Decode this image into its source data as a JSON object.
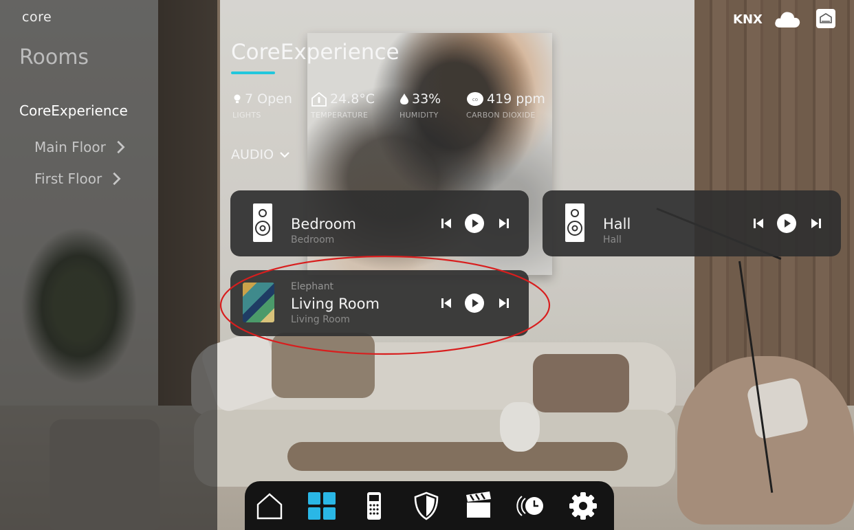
{
  "app": {
    "logo_text": "core"
  },
  "sidebar": {
    "title": "Rooms",
    "home": "CoreExperience",
    "items": [
      {
        "label": "Main Floor"
      },
      {
        "label": "First Floor"
      }
    ]
  },
  "status": {
    "knx": "KNX",
    "icons": [
      "cloud-icon",
      "home-box-icon"
    ]
  },
  "header": {
    "title": "CoreExperience",
    "accent": "#22c7dc"
  },
  "stats": [
    {
      "value": "7 Open",
      "label": "LIGHTS",
      "icon": "bulb-icon"
    },
    {
      "value": "24.8°C",
      "label": "TEMPERATURE",
      "icon": "house-thermo-icon"
    },
    {
      "value": "33%",
      "label": "HUMIDITY",
      "icon": "droplet-icon"
    },
    {
      "value": "419 ppm",
      "label": "CARBON DIOXIDE",
      "icon": "co2-icon"
    }
  ],
  "audio_section": {
    "label": "AUDIO"
  },
  "players": [
    {
      "name": "Bedroom",
      "subtitle": "Bedroom",
      "track": ""
    },
    {
      "name": "Hall",
      "subtitle": "Hall",
      "track": ""
    },
    {
      "name": "Living Room",
      "subtitle": "Living Room",
      "track": "Elephant"
    }
  ],
  "dock": {
    "items": [
      "home-icon",
      "rooms-grid-icon",
      "remote-icon",
      "security-shield-icon",
      "scenes-clapper-icon",
      "schedule-clock-icon",
      "settings-gear-icon"
    ],
    "active": "rooms-grid-icon",
    "active_color": "#2ab7e6"
  },
  "annotation_color": "#d81e1e"
}
